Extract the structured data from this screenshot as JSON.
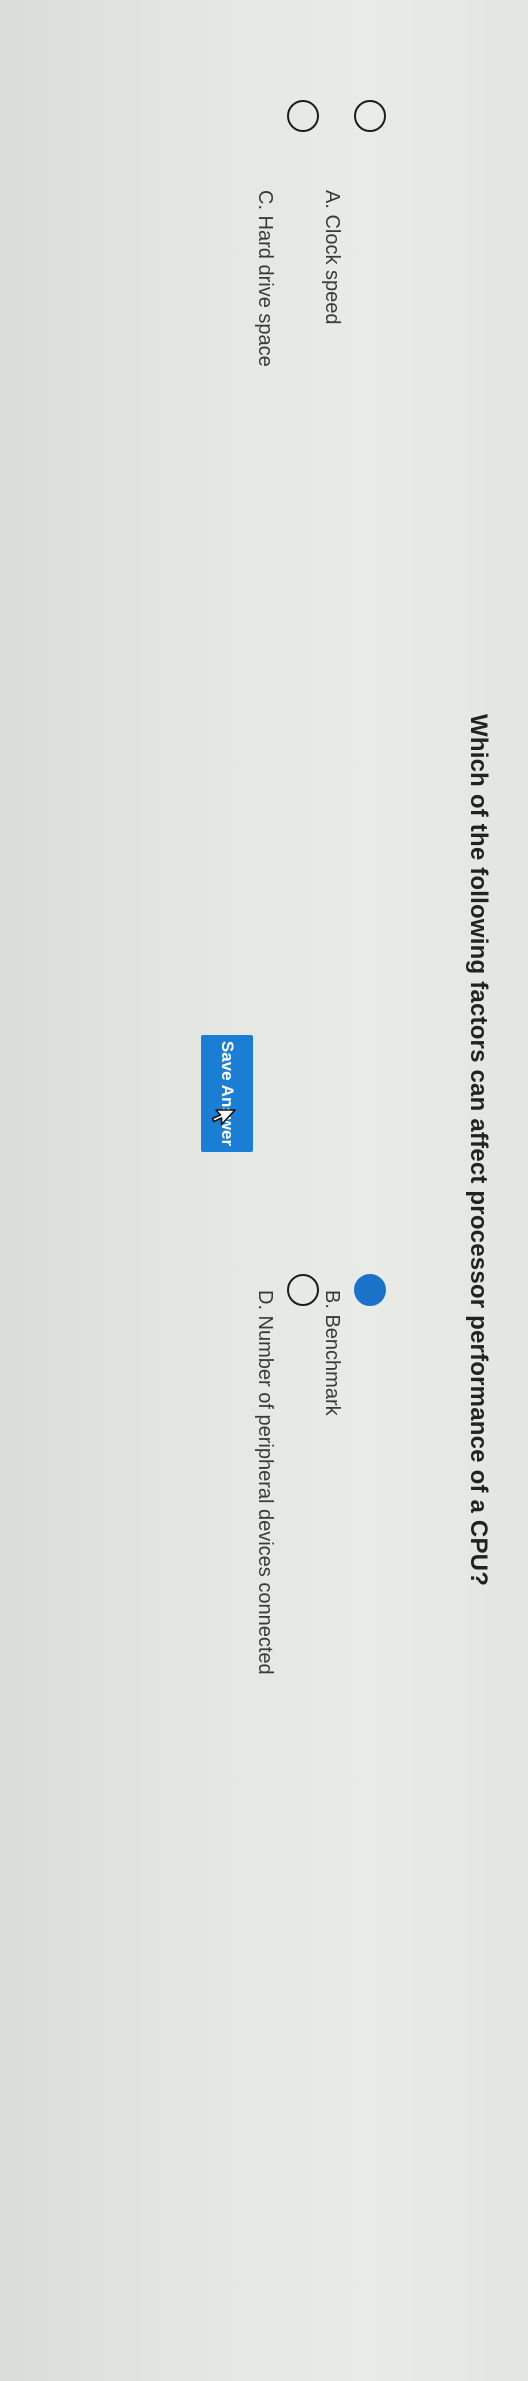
{
  "question": {
    "text": "Which of the following factors can affect processor performance of a CPU?"
  },
  "options": [
    {
      "label": "A. Clock speed",
      "selected": false
    },
    {
      "label": "B. Benchmark",
      "selected": true
    },
    {
      "label": "C. Hard drive space",
      "selected": false
    },
    {
      "label": "D. Number of peripheral devices connected",
      "selected": false
    }
  ],
  "actions": {
    "save_label": "Save Answer"
  },
  "colors": {
    "accent": "#1a7fd4",
    "selected_radio": "#1a73c8",
    "text": "#222222"
  },
  "icons": {
    "cursor": "mouse-pointer-icon"
  }
}
